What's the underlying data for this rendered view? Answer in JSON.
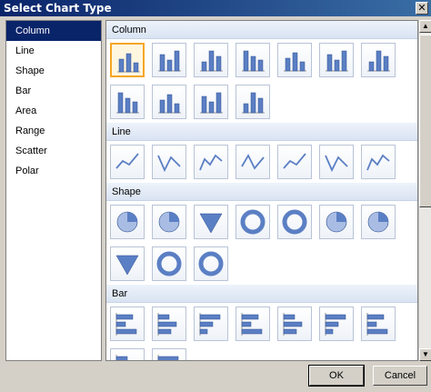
{
  "window": {
    "title": "Select Chart Type"
  },
  "sidebar": {
    "items": [
      {
        "label": "Column",
        "selected": true
      },
      {
        "label": "Line"
      },
      {
        "label": "Shape"
      },
      {
        "label": "Bar"
      },
      {
        "label": "Area"
      },
      {
        "label": "Range"
      },
      {
        "label": "Scatter"
      },
      {
        "label": "Polar"
      }
    ]
  },
  "gallery": {
    "sections": [
      {
        "title": "Column",
        "rows": [
          7,
          4
        ],
        "icon": "column-chart-icon"
      },
      {
        "title": "Line",
        "rows": [
          7
        ],
        "icon": "line-chart-icon"
      },
      {
        "title": "Shape",
        "rows": [
          7,
          3
        ],
        "icon": "shape-chart-icon"
      },
      {
        "title": "Bar",
        "rows": [
          7,
          2
        ],
        "icon": "bar-chart-icon"
      }
    ]
  },
  "buttons": {
    "ok": "OK",
    "cancel": "Cancel"
  },
  "colors": {
    "accent": "#0a246a",
    "selection_border": "#f5a623",
    "icon_blue": "#5b7fc4"
  }
}
